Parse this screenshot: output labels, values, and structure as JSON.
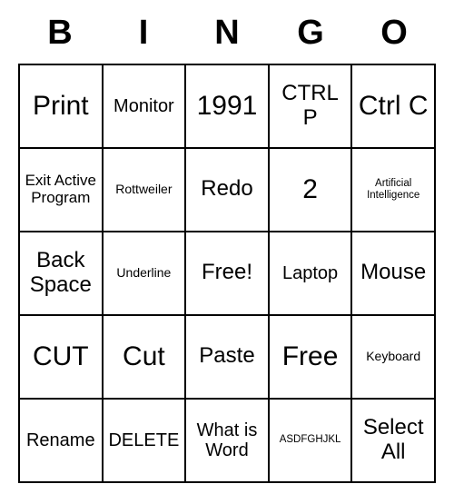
{
  "header": [
    "B",
    "I",
    "N",
    "G",
    "O"
  ],
  "grid": [
    [
      {
        "text": "Print",
        "size": "fs-xl"
      },
      {
        "text": "Monitor",
        "size": "fs-m"
      },
      {
        "text": "1991",
        "size": "fs-xl"
      },
      {
        "text": "CTRL P",
        "size": "fs-l"
      },
      {
        "text": "Ctrl C",
        "size": "fs-xl"
      }
    ],
    [
      {
        "text": "Exit Active Program",
        "size": "fs-s"
      },
      {
        "text": "Rottweiler",
        "size": "fs-xs"
      },
      {
        "text": "Redo",
        "size": "fs-l"
      },
      {
        "text": "2",
        "size": "fs-xl"
      },
      {
        "text": "Artificial Intelligence",
        "size": "fs-xxs"
      }
    ],
    [
      {
        "text": "Back Space",
        "size": "fs-l"
      },
      {
        "text": "Underline",
        "size": "fs-xs"
      },
      {
        "text": "Free!",
        "size": "fs-l"
      },
      {
        "text": "Laptop",
        "size": "fs-m"
      },
      {
        "text": "Mouse",
        "size": "fs-l"
      }
    ],
    [
      {
        "text": "CUT",
        "size": "fs-xl"
      },
      {
        "text": "Cut",
        "size": "fs-xl"
      },
      {
        "text": "Paste",
        "size": "fs-l"
      },
      {
        "text": "Free",
        "size": "fs-xl"
      },
      {
        "text": "Keyboard",
        "size": "fs-xs"
      }
    ],
    [
      {
        "text": "Rename",
        "size": "fs-m"
      },
      {
        "text": "DELETE",
        "size": "fs-m"
      },
      {
        "text": "What is Word",
        "size": "fs-m"
      },
      {
        "text": "ASDFGHJKL",
        "size": "fs-xxs"
      },
      {
        "text": "Select All",
        "size": "fs-l"
      }
    ]
  ]
}
